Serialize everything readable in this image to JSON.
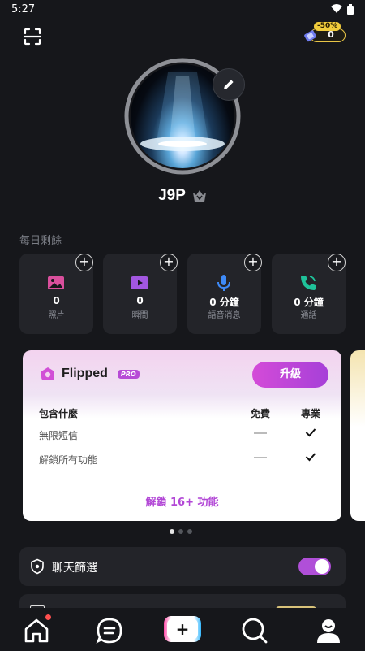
{
  "status_bar": {
    "time": "5:27",
    "icons": [
      "wifi-icon",
      "battery-icon"
    ]
  },
  "header": {
    "scan_icon": "scan-icon",
    "coins": {
      "discount": "-50%",
      "balance": "0",
      "icon": "ticket-icon"
    }
  },
  "profile": {
    "username": "J9P",
    "badge_icon": "verified-shield-icon",
    "edit_icon": "pencil-icon"
  },
  "daily_remaining": {
    "title": "每日剩餘",
    "items": [
      {
        "value": "0",
        "label": "照片",
        "icon": "photo-icon",
        "color": "#d94f9c"
      },
      {
        "value": "0",
        "label": "瞬間",
        "icon": "video-icon",
        "color": "#a257e0"
      },
      {
        "value": "0 分鐘",
        "label": "語音消息",
        "icon": "microphone-icon",
        "color": "#3e8af7"
      },
      {
        "value": "0 分鐘",
        "label": "通話",
        "icon": "phone-icon",
        "color": "#1fc29a"
      }
    ],
    "add_label": "+"
  },
  "promo": {
    "brand": "Flipped",
    "pro_badge": "PRO",
    "upgrade_label": "升級",
    "header_feature": "包含什麼",
    "header_free": "免費",
    "header_pro": "專業",
    "features": [
      {
        "label": "無限短信"
      },
      {
        "label": "解鎖所有功能"
      }
    ],
    "unlock_label": "解鎖 16+ 功能",
    "accent": "#b247d6"
  },
  "pager": {
    "count": 3,
    "active": 0
  },
  "settings": {
    "chat_filter": {
      "label": "聊天篩選",
      "enabled": true,
      "icon": "shield-icon"
    }
  },
  "bottom_nav": {
    "items": [
      "home-icon",
      "chat-icon",
      "create-icon",
      "search-icon",
      "profile-icon"
    ],
    "create_label": "+"
  }
}
